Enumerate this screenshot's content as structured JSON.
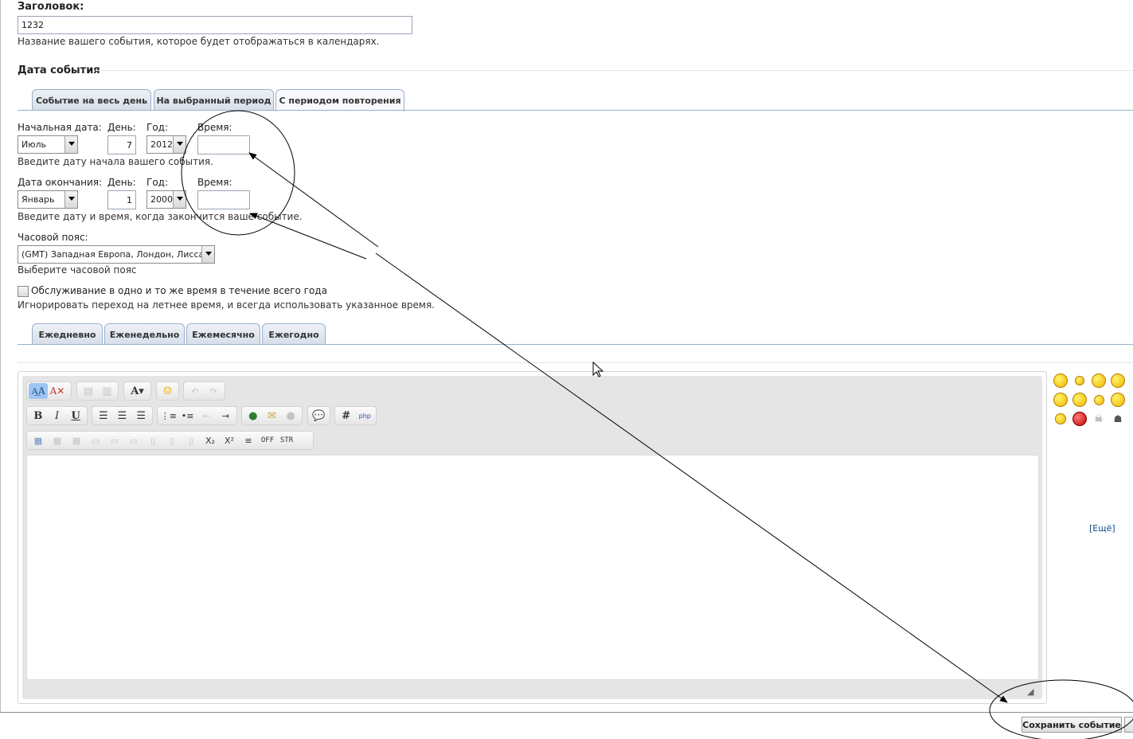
{
  "title_section": {
    "label": "Заголовок:",
    "value": "1232",
    "hint": "Название вашего события, которое будет отображаться в календарях."
  },
  "date_section": {
    "legend": "Дата события",
    "tabs": [
      "Событие на весь день",
      "На выбранный период",
      "С периодом повторения"
    ],
    "active_tab": 2
  },
  "start": {
    "label": "Начальная дата:",
    "day_label": "День:",
    "year_label": "Год:",
    "time_label": "Время:",
    "month": "Июль",
    "day": "7",
    "year": "2012",
    "time": "",
    "hint": "Введите дату начала вашего события."
  },
  "end": {
    "label": "Дата окончания:",
    "day_label": "День:",
    "year_label": "Год:",
    "time_label": "Время:",
    "month": "Январь",
    "day": "1",
    "year": "2000",
    "time": "",
    "hint": "Введите дату и время, когда закончится ваше событие."
  },
  "timezone": {
    "label": "Часовой пояс:",
    "value": "(GMT) Западная Европа, Лондон, Лиссабон,",
    "hint": "Выберите часовой пояс"
  },
  "dst": {
    "checkbox_label": "Обслуживание в одно и то же время в течение всего года",
    "checked": false,
    "hint": "Игнорировать переход на летнее время, и всегда использовать указанное время."
  },
  "repeat_tabs": [
    "Ежедневно",
    "Еженедельно",
    "Ежемесячно",
    "Ежегодно"
  ],
  "toolbar": {
    "row1": [
      "switch-mode-icon",
      "remove-format-icon",
      "paste-icon",
      "paste-text-icon",
      "font-icon",
      "smilie-icon",
      "undo-icon",
      "redo-icon"
    ],
    "bold": "B",
    "italic": "I",
    "underline": "U",
    "hash": "#",
    "php": "php",
    "off": "OFF",
    "str": "STR",
    "sub": "X₂",
    "sup": "X²"
  },
  "editor": {
    "content": ""
  },
  "smilies": {
    "more_link": "[Ещё]"
  },
  "actions": {
    "save": "Сохранить событие"
  },
  "colors": {
    "accent": "#0b4a8b",
    "tab_border": "#9bb0c9",
    "annotation": "#000000"
  }
}
